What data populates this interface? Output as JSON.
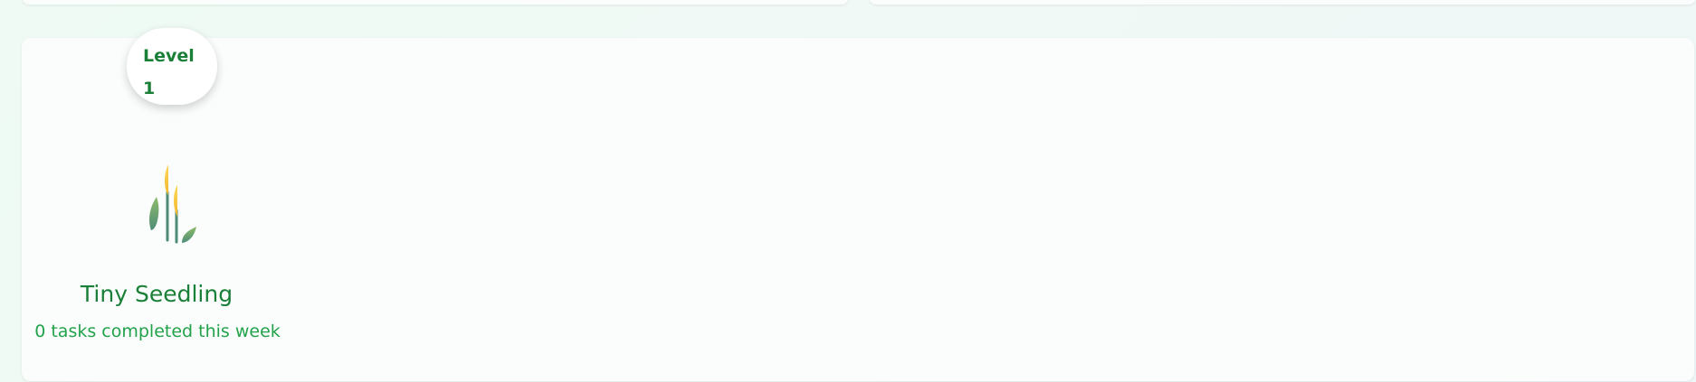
{
  "level_badge": {
    "prefix": "Level",
    "number": "1"
  },
  "plant": {
    "icon": "sheaf-of-rice-icon",
    "title": "Tiny Seedling",
    "subtitle": "0 tasks completed this week"
  },
  "colors": {
    "accent": "#1a7f37",
    "subtext": "#22a24a",
    "card_background": "#fafdfb",
    "page_background": "#eef8f3"
  }
}
